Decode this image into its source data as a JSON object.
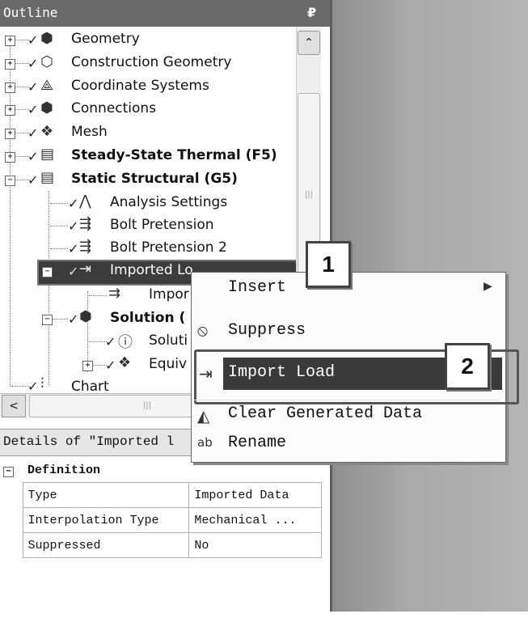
{
  "outline": {
    "title": "Outline",
    "pin": "₽"
  },
  "tree": [
    {
      "label": "Geometry",
      "icon": "geometry-icon",
      "bold": false
    },
    {
      "label": "Construction Geometry",
      "icon": "construction-geometry-icon",
      "bold": false
    },
    {
      "label": "Coordinate Systems",
      "icon": "coordinate-systems-icon",
      "bold": false
    },
    {
      "label": "Connections",
      "icon": "connections-icon",
      "bold": false
    },
    {
      "label": "Mesh",
      "icon": "mesh-icon",
      "bold": false
    },
    {
      "label": "Steady-State Thermal (F5)",
      "icon": "thermal-icon",
      "bold": true
    },
    {
      "label": "Static Structural (G5)",
      "icon": "structural-icon",
      "bold": true
    },
    {
      "label": "Analysis Settings",
      "icon": "analysis-settings-icon",
      "bold": false
    },
    {
      "label": "Bolt Pretension",
      "icon": "bolt-pretension-icon",
      "bold": false
    },
    {
      "label": "Bolt Pretension 2",
      "icon": "bolt-pretension-icon",
      "bold": false
    },
    {
      "label": "Imported Lo",
      "icon": "imported-load-icon",
      "bold": false
    },
    {
      "label": "Impor",
      "icon": "import-icon",
      "bold": false
    },
    {
      "label": "Solution (",
      "icon": "solution-icon",
      "bold": true
    },
    {
      "label": "Soluti",
      "icon": "solution-info-icon",
      "bold": false
    },
    {
      "label": "Equiv",
      "icon": "equivalent-stress-icon",
      "bold": false
    },
    {
      "label": "Chart",
      "icon": "chart-icon",
      "bold": false
    }
  ],
  "scroll": {
    "up": "⌃",
    "left": "<",
    "grip": "|||"
  },
  "details": {
    "title": "Details of \"Imported l",
    "group": "Definition",
    "rows": [
      {
        "key": "Type",
        "value": "Imported Data"
      },
      {
        "key": "Interpolation Type",
        "value": "Mechanical ..."
      },
      {
        "key": "Suppressed",
        "value": "No"
      }
    ]
  },
  "context_menu": {
    "items": [
      {
        "label": "Insert",
        "icon": "",
        "submenu": "▶"
      },
      {
        "label": "Suppress",
        "icon": "suppress-icon"
      },
      {
        "label": "Import Load",
        "icon": "import-load-icon"
      },
      {
        "label": "Clear Generated Data",
        "icon": "clear-data-icon"
      },
      {
        "label": "Rename",
        "icon": "rename-icon"
      }
    ]
  },
  "callouts": [
    "1",
    "2"
  ]
}
